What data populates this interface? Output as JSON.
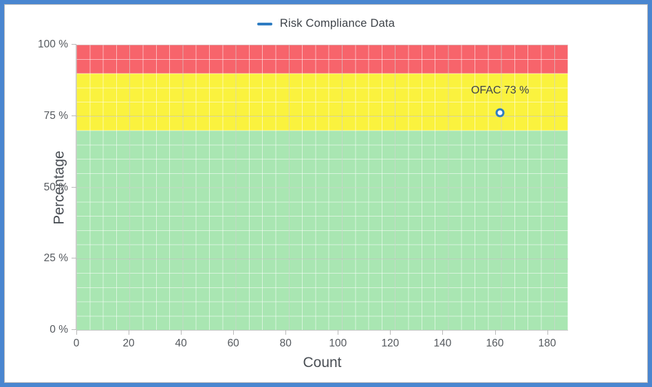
{
  "frame": {
    "outer_border_color": "#4a86d0",
    "inner_border_color": "#b9b9b9",
    "background": "#ffffff"
  },
  "legend": {
    "position": "top-center",
    "items": [
      {
        "label": "Risk Compliance Data",
        "color": "#2e7cc2",
        "marker": "line"
      }
    ]
  },
  "chart_data": {
    "type": "scatter",
    "title": "",
    "subtitle": "",
    "xlabel": "Count",
    "ylabel": "Percentage",
    "xlim": [
      0,
      188
    ],
    "ylim": [
      0,
      100
    ],
    "grid": true,
    "legend_position": "top-center",
    "xticks": [
      0,
      20,
      40,
      60,
      80,
      100,
      120,
      140,
      160,
      180
    ],
    "xtick_labels": [
      "0",
      "20",
      "40",
      "60",
      "80",
      "100",
      "120",
      "140",
      "160",
      "180"
    ],
    "yticks": [
      0,
      25,
      50,
      75,
      100
    ],
    "ytick_labels": [
      "0 %",
      "25 %",
      "50 %",
      "75 %",
      "100 %"
    ],
    "series": [
      {
        "name": "Risk Compliance Data",
        "color": "#2e7cc2",
        "points": [
          {
            "label": "OFAC 73 %",
            "name": "OFAC",
            "x": 162,
            "y": 73
          }
        ]
      }
    ],
    "bands": [
      {
        "name": "green-zone",
        "color": "#a9e6b2",
        "y_from": 0,
        "y_to": 70
      },
      {
        "name": "yellow-zone",
        "color": "#faf23e",
        "y_from": 70,
        "y_to": 90
      },
      {
        "name": "red-zone",
        "color": "#f7646b",
        "y_from": 90,
        "y_to": 100
      }
    ]
  }
}
